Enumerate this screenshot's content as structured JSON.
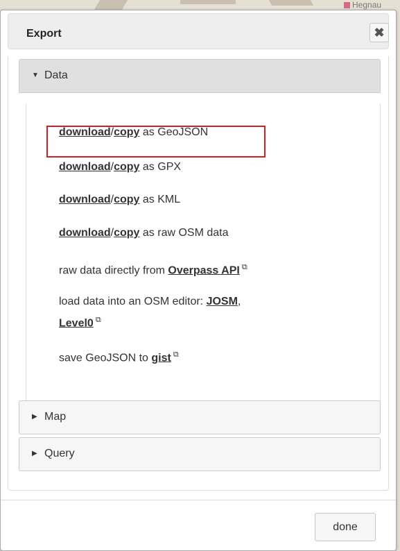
{
  "dialog": {
    "title": "Export",
    "close_icon": "close-icon",
    "done_label": "done"
  },
  "map_labels": [
    "Hegnau"
  ],
  "sections": [
    {
      "label": "Data",
      "expanded": true
    },
    {
      "label": "Map",
      "expanded": false
    },
    {
      "label": "Query",
      "expanded": false
    }
  ],
  "data_panel": {
    "link_download": "download",
    "separator": "/",
    "link_copy": "copy",
    "rows": [
      {
        "suffix": " as GeoJSON"
      },
      {
        "suffix": " as GPX"
      },
      {
        "suffix": " as KML"
      },
      {
        "suffix": " as raw OSM data"
      }
    ],
    "overpass_prefix": "raw data directly from ",
    "overpass_link": "Overpass API",
    "editor_prefix": "load data into an OSM editor: ",
    "editor_josm": "JOSM",
    "editor_comma": ",",
    "editor_level0": "Level0",
    "gist_prefix": "save GeoJSON to ",
    "gist_link": "gist",
    "external_icon": "external-link-icon"
  },
  "colors": {
    "highlight_border": "#d21f1f"
  }
}
